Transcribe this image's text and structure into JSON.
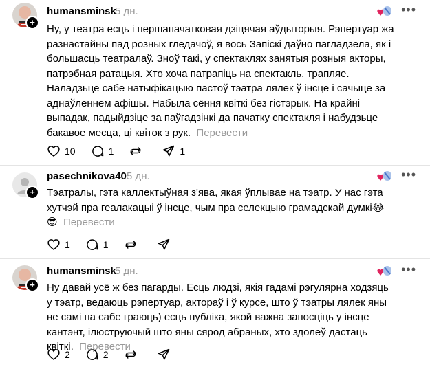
{
  "posts": [
    {
      "username": "humansminsk",
      "time": "5 дн.",
      "text": "Ну, у театра есць і першапачатковая дзіцячая аўдыторыя. Рэпертуар жа разнастайны пад розных гледачоў, я вось Запіскі даўно пагладзела, як і большасць театралаў. Зноў такі, у спектаклях занятыя розныя акторы, патрэбная ратацыя. Хто хоча патрапіць на спектакль, трапляе. Наладзьце сабе натыфікацыю пастоў тэатра лялек ў інсце і сачыце за аднаўленнем афішы. Набыла сёння квіткі без гістэрык. На крайні выпадак, падыйдзіце за паўгадзінкі да пачатку спектакля і набудзьце бакавое месца, ці квіток з рук.",
      "translate": "Перевести",
      "likes": "10",
      "replies": "1",
      "reposts": "",
      "shares": "1"
    },
    {
      "username": "pasechnikova40",
      "time": "5 дн.",
      "text": "Тэатралы, гэта каллектыўная з'ява, якая ўплывае на тэатр. У нас гэта хутчэй пра геалакацыі ў інсце, чым пра селекцыю грамадскай думкі😂 😎",
      "translate": "Перевести",
      "likes": "1",
      "replies": "1",
      "reposts": "",
      "shares": ""
    },
    {
      "username": "humansminsk",
      "time": "5 дн.",
      "text": "Ну давай усё ж без пагарды. Есць людзі, якія гадамі рэгулярна ходзяць у тэатр, ведаюць рэпертуар, актораў і ў курсе, што ў тэатры лялек яны не самі па сабе граюць) есць публіка, якой важна запосціць у інсце кантэнт, ілюструючый што яны сярод абраных, хто здолеў дастаць квіткі.",
      "translate": "Перевести",
      "likes": "2",
      "replies": "2",
      "reposts": "",
      "shares": ""
    }
  ],
  "icons": {
    "more": "more-icon",
    "like": "heart-icon",
    "reply": "comment-icon",
    "repost": "repost-icon",
    "share": "send-icon",
    "follow": "plus-icon",
    "badge": "heart-flag-badge-icon"
  },
  "colors": {
    "muted": "#999999",
    "badge_heart": "#e0245e",
    "badge_flag": "#4a76c9"
  }
}
